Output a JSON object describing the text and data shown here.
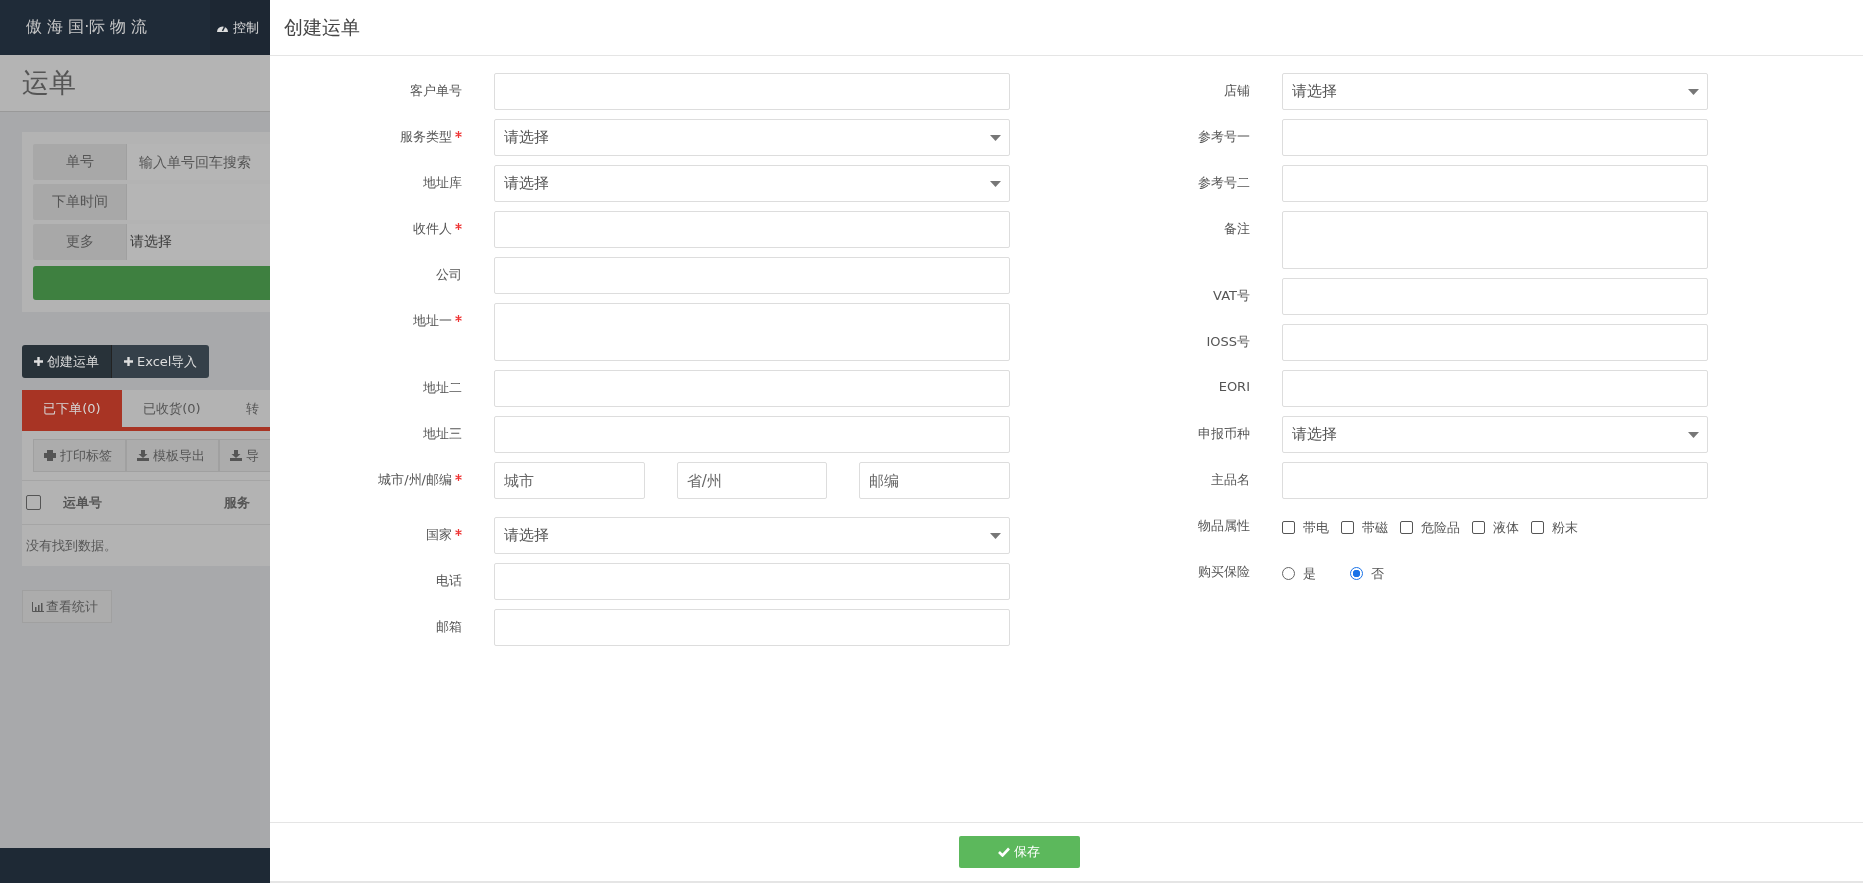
{
  "app": {
    "brand": "傲 海 国·际 物 流",
    "nav_items": [
      "控制"
    ],
    "page_title": "运单",
    "filters": [
      {
        "kind": "input",
        "label": "单号",
        "placeholder": "输入单号回车搜索"
      },
      {
        "kind": "input",
        "label": "下单时间"
      },
      {
        "kind": "select",
        "label": "更多",
        "value": "请选择"
      }
    ],
    "actions": [
      "创建运单",
      "Excel导入"
    ],
    "tabs": [
      {
        "label": "已下单(0)",
        "selected": true
      },
      {
        "label": "已收货(0)",
        "selected": false
      },
      {
        "label": "转",
        "selected": false
      }
    ],
    "toolbar": [
      "打印标签",
      "模板导出",
      "导"
    ],
    "table": {
      "select_all_checked": false,
      "columns": [
        "运单号",
        "服务"
      ],
      "empty_text": "没有找到数据。"
    },
    "stats_button": "查看统计"
  },
  "modal": {
    "title": "创建运单",
    "left_fields": [
      {
        "kind": "text",
        "label": "客户单号"
      },
      {
        "kind": "select",
        "label": "服务类型",
        "required": true,
        "value": "请选择"
      },
      {
        "kind": "select",
        "label": "地址库",
        "value": "请选择"
      },
      {
        "kind": "text",
        "label": "收件人",
        "required": true
      },
      {
        "kind": "text",
        "label": "公司"
      },
      {
        "kind": "textarea",
        "label": "地址一",
        "required": true
      },
      {
        "kind": "text",
        "label": "地址二"
      },
      {
        "kind": "text",
        "label": "地址三"
      },
      {
        "kind": "triple",
        "label": "城市/州/邮编",
        "required": true,
        "parts": [
          {
            "placeholder": "城市"
          },
          {
            "placeholder": "省/州"
          },
          {
            "placeholder": "邮编"
          }
        ]
      },
      {
        "kind": "select",
        "label": "国家",
        "required": true,
        "value": "请选择"
      },
      {
        "kind": "text",
        "label": "电话"
      },
      {
        "kind": "text",
        "label": "邮箱"
      }
    ],
    "right_fields": [
      {
        "kind": "select",
        "label": "店铺",
        "value": "请选择"
      },
      {
        "kind": "text",
        "label": "参考号一"
      },
      {
        "kind": "text",
        "label": "参考号二"
      },
      {
        "kind": "textarea",
        "label": "备注"
      },
      {
        "kind": "text",
        "label": "VAT号"
      },
      {
        "kind": "text",
        "label": "IOSS号"
      },
      {
        "kind": "text",
        "label": "EORI"
      },
      {
        "kind": "select",
        "label": "申报币种",
        "value": "请选择"
      },
      {
        "kind": "text",
        "label": "主品名"
      },
      {
        "kind": "checkboxes",
        "label": "物品属性",
        "options": [
          {
            "label": "带电",
            "checked": false
          },
          {
            "label": "带磁",
            "checked": false
          },
          {
            "label": "危险品",
            "checked": false
          },
          {
            "label": "液体",
            "checked": false
          },
          {
            "label": "粉末",
            "checked": false
          }
        ]
      },
      {
        "kind": "radios",
        "label": "购买保险",
        "options": [
          {
            "label": "是",
            "selected": false
          },
          {
            "label": "否",
            "selected": true
          }
        ]
      }
    ],
    "save_button": "保存"
  }
}
